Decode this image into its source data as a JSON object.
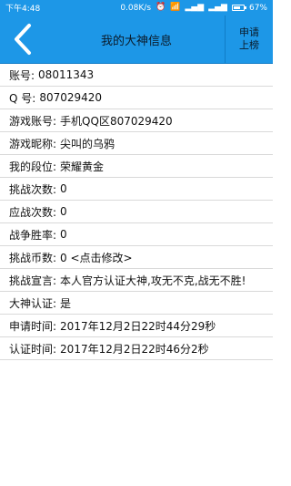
{
  "status": {
    "time": "下午4:48",
    "net_speed": "0.08K/s",
    "battery_percent": "67%",
    "battery_level": 0.67
  },
  "header": {
    "title": "我的大神信息",
    "apply_line1": "申请",
    "apply_line2": "上榜"
  },
  "rows": [
    {
      "label": "账号:",
      "value": "08011343"
    },
    {
      "label": "Q 号:",
      "value": "807029420"
    },
    {
      "label": "游戏账号:",
      "value": "手机QQ区807029420"
    },
    {
      "label": "游戏昵称:",
      "value": "尖叫的乌鸦"
    },
    {
      "label": "我的段位:",
      "value": "荣耀黄金"
    },
    {
      "label": "挑战次数:",
      "value": "0"
    },
    {
      "label": "应战次数:",
      "value": "0"
    },
    {
      "label": "战争胜率:",
      "value": "0"
    },
    {
      "label": "挑战币数:",
      "value": "0  <点击修改>"
    },
    {
      "label": "挑战宣言:",
      "value": "本人官方认证大神,攻无不克,战无不胜!"
    },
    {
      "label": "大神认证:",
      "value": "是"
    },
    {
      "label": "申请时间:",
      "value": "2017年12月2日22时44分29秒"
    },
    {
      "label": "认证时间:",
      "value": "2017年12月2日22时46分2秒"
    }
  ],
  "icons": {
    "back": "chevron-left-icon"
  }
}
